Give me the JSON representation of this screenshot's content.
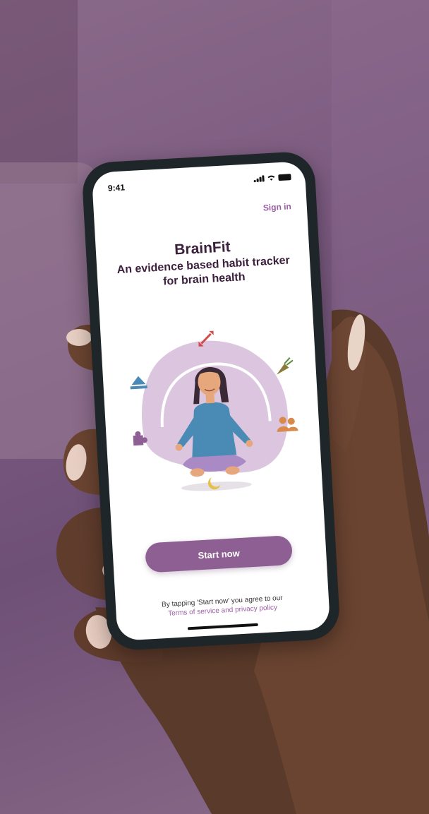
{
  "status_bar": {
    "time": "9:41"
  },
  "header": {
    "sign_in_label": "Sign in"
  },
  "hero": {
    "title": "BrainFit",
    "subtitle": "An evidence based habit tracker for brain health"
  },
  "cta": {
    "start_label": "Start now"
  },
  "legal": {
    "text": "By tapping 'Start now' you agree to our",
    "link": "Terms of service and privacy policy"
  },
  "colors": {
    "accent": "#8d5f92",
    "link": "#9a5ea4",
    "title": "#3b1f3c",
    "blob": "#dcc6df"
  },
  "icons": [
    "signal-icon",
    "wifi-icon",
    "battery-icon",
    "exercise-arrows-icon",
    "meditation-bell-icon",
    "carrot-icon",
    "puzzle-icon",
    "people-icon",
    "moon-icon"
  ]
}
